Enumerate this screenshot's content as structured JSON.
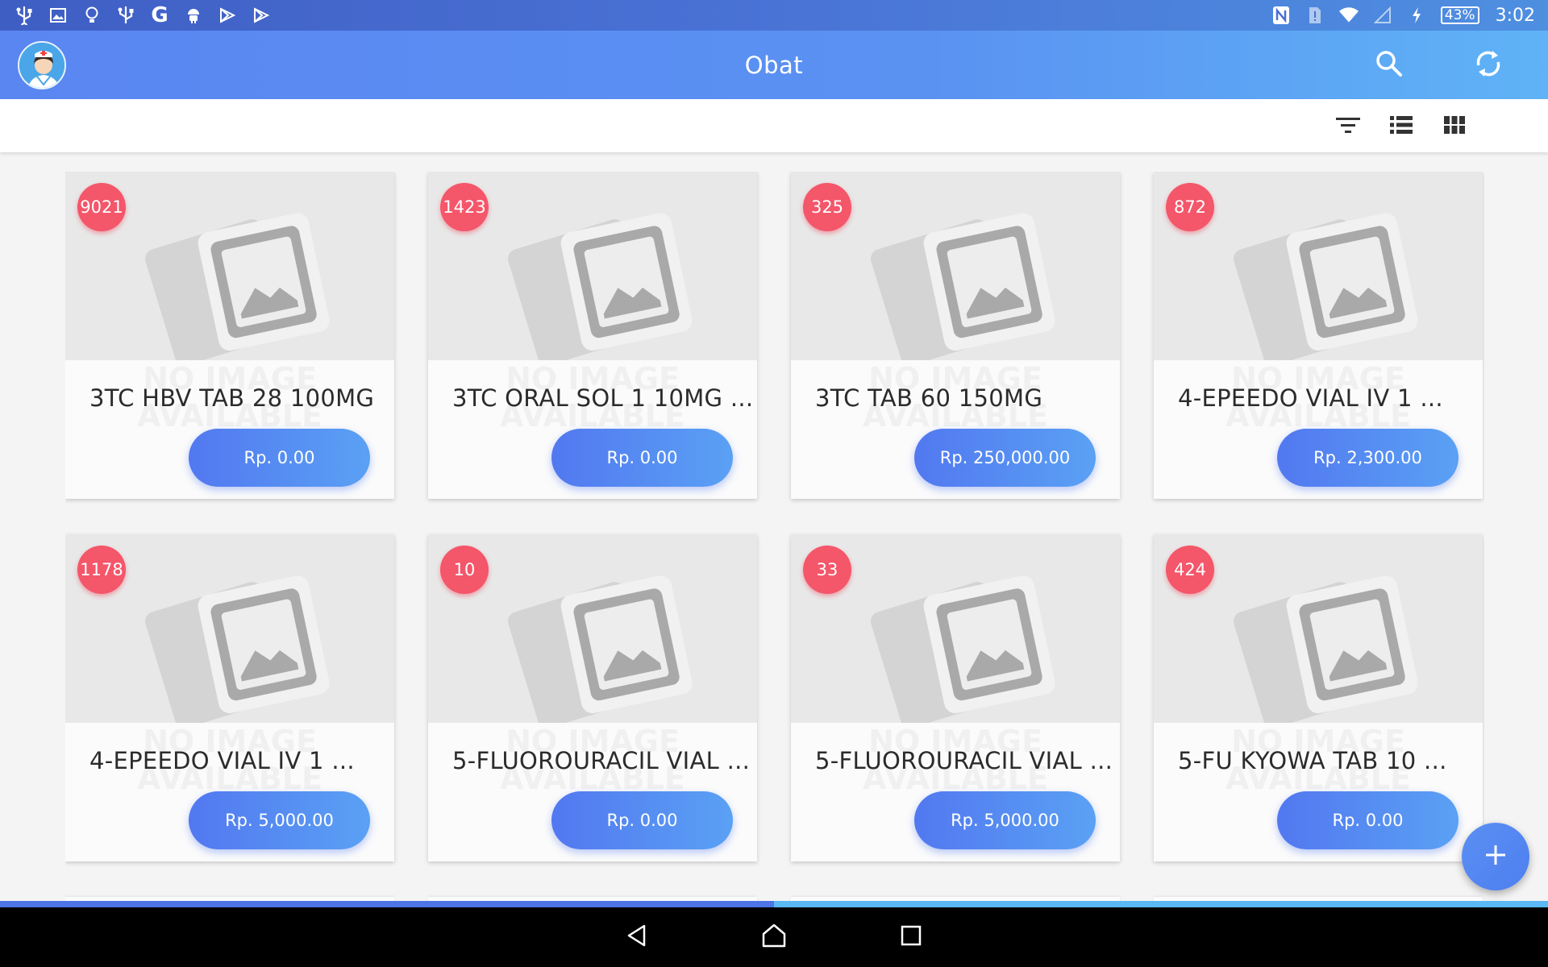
{
  "status_bar": {
    "left_icons": [
      "usb-icon",
      "image-icon",
      "lightbulb-icon",
      "usb-debug-icon",
      "google-icon",
      "android-icon",
      "play-store-icon",
      "play-store-icon"
    ],
    "right_icons": [
      "nfc-icon",
      "sim-alert-icon",
      "wifi-icon",
      "signal-icon",
      "charging-icon"
    ],
    "battery": "43%",
    "time": "3:02"
  },
  "app_bar": {
    "title": "Obat",
    "search_icon": "search-icon",
    "refresh_icon": "refresh-icon"
  },
  "toolbar": {
    "icons": [
      "filter-icon",
      "list-view-icon",
      "grid-view-icon"
    ]
  },
  "products": [
    {
      "stock": "9021",
      "name": "3TC HBV TAB 28 100MG",
      "price": "Rp. 0.00"
    },
    {
      "stock": "1423",
      "name": "3TC ORAL SOL 1 10MG ...",
      "price": "Rp. 0.00"
    },
    {
      "stock": "325",
      "name": "3TC TAB 60 150MG",
      "price": "Rp. 250,000.00"
    },
    {
      "stock": "872",
      "name": "4-EPEEDO VIAL IV 1 ...",
      "price": "Rp. 2,300.00"
    },
    {
      "stock": "1178",
      "name": "4-EPEEDO VIAL IV 1 ...",
      "price": "Rp. 5,000.00"
    },
    {
      "stock": "10",
      "name": "5-FLUOROURACIL VIAL ...",
      "price": "Rp. 0.00"
    },
    {
      "stock": "33",
      "name": "5-FLUOROURACIL VIAL ...",
      "price": "Rp. 5,000.00"
    },
    {
      "stock": "424",
      "name": "5-FU KYOWA TAB 10 ...",
      "price": "Rp. 0.00"
    }
  ],
  "placeholder_watermark": [
    "NO IMAGE",
    "AVAILABLE"
  ],
  "progress_fraction": 0.5,
  "fab_icon": "add-icon",
  "nav_bar": {
    "buttons": [
      "back-icon",
      "home-icon",
      "recents-icon"
    ]
  },
  "colors": {
    "app_bar_start": "#5a86f2",
    "app_bar_end": "#5fb3f6",
    "badge": "#f4566a",
    "price_button_start": "#5278f0",
    "price_button_end": "#5aa1f4"
  }
}
